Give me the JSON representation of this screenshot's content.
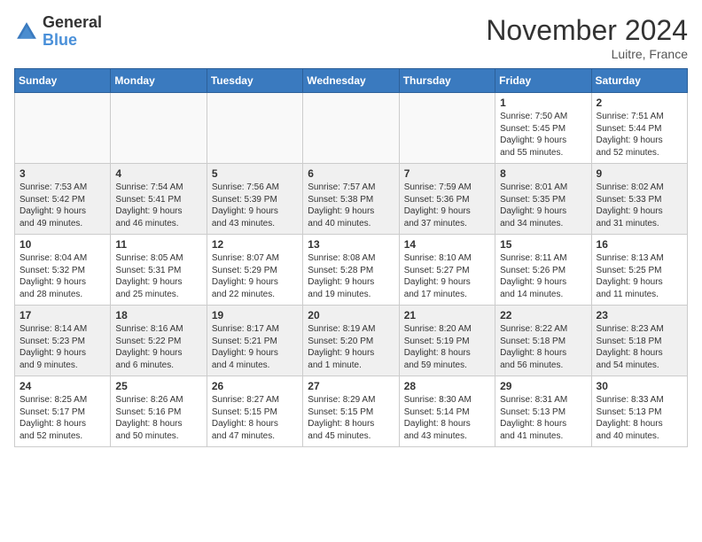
{
  "header": {
    "logo_line1": "General",
    "logo_line2": "Blue",
    "month": "November 2024",
    "location": "Luitre, France"
  },
  "weekdays": [
    "Sunday",
    "Monday",
    "Tuesday",
    "Wednesday",
    "Thursday",
    "Friday",
    "Saturday"
  ],
  "weeks": [
    [
      {
        "day": "",
        "text": "",
        "empty": true
      },
      {
        "day": "",
        "text": "",
        "empty": true
      },
      {
        "day": "",
        "text": "",
        "empty": true
      },
      {
        "day": "",
        "text": "",
        "empty": true
      },
      {
        "day": "",
        "text": "",
        "empty": true
      },
      {
        "day": "1",
        "text": "Sunrise: 7:50 AM\nSunset: 5:45 PM\nDaylight: 9 hours\nand 55 minutes.",
        "empty": false
      },
      {
        "day": "2",
        "text": "Sunrise: 7:51 AM\nSunset: 5:44 PM\nDaylight: 9 hours\nand 52 minutes.",
        "empty": false
      }
    ],
    [
      {
        "day": "3",
        "text": "Sunrise: 7:53 AM\nSunset: 5:42 PM\nDaylight: 9 hours\nand 49 minutes.",
        "empty": false
      },
      {
        "day": "4",
        "text": "Sunrise: 7:54 AM\nSunset: 5:41 PM\nDaylight: 9 hours\nand 46 minutes.",
        "empty": false
      },
      {
        "day": "5",
        "text": "Sunrise: 7:56 AM\nSunset: 5:39 PM\nDaylight: 9 hours\nand 43 minutes.",
        "empty": false
      },
      {
        "day": "6",
        "text": "Sunrise: 7:57 AM\nSunset: 5:38 PM\nDaylight: 9 hours\nand 40 minutes.",
        "empty": false
      },
      {
        "day": "7",
        "text": "Sunrise: 7:59 AM\nSunset: 5:36 PM\nDaylight: 9 hours\nand 37 minutes.",
        "empty": false
      },
      {
        "day": "8",
        "text": "Sunrise: 8:01 AM\nSunset: 5:35 PM\nDaylight: 9 hours\nand 34 minutes.",
        "empty": false
      },
      {
        "day": "9",
        "text": "Sunrise: 8:02 AM\nSunset: 5:33 PM\nDaylight: 9 hours\nand 31 minutes.",
        "empty": false
      }
    ],
    [
      {
        "day": "10",
        "text": "Sunrise: 8:04 AM\nSunset: 5:32 PM\nDaylight: 9 hours\nand 28 minutes.",
        "empty": false
      },
      {
        "day": "11",
        "text": "Sunrise: 8:05 AM\nSunset: 5:31 PM\nDaylight: 9 hours\nand 25 minutes.",
        "empty": false
      },
      {
        "day": "12",
        "text": "Sunrise: 8:07 AM\nSunset: 5:29 PM\nDaylight: 9 hours\nand 22 minutes.",
        "empty": false
      },
      {
        "day": "13",
        "text": "Sunrise: 8:08 AM\nSunset: 5:28 PM\nDaylight: 9 hours\nand 19 minutes.",
        "empty": false
      },
      {
        "day": "14",
        "text": "Sunrise: 8:10 AM\nSunset: 5:27 PM\nDaylight: 9 hours\nand 17 minutes.",
        "empty": false
      },
      {
        "day": "15",
        "text": "Sunrise: 8:11 AM\nSunset: 5:26 PM\nDaylight: 9 hours\nand 14 minutes.",
        "empty": false
      },
      {
        "day": "16",
        "text": "Sunrise: 8:13 AM\nSunset: 5:25 PM\nDaylight: 9 hours\nand 11 minutes.",
        "empty": false
      }
    ],
    [
      {
        "day": "17",
        "text": "Sunrise: 8:14 AM\nSunset: 5:23 PM\nDaylight: 9 hours\nand 9 minutes.",
        "empty": false
      },
      {
        "day": "18",
        "text": "Sunrise: 8:16 AM\nSunset: 5:22 PM\nDaylight: 9 hours\nand 6 minutes.",
        "empty": false
      },
      {
        "day": "19",
        "text": "Sunrise: 8:17 AM\nSunset: 5:21 PM\nDaylight: 9 hours\nand 4 minutes.",
        "empty": false
      },
      {
        "day": "20",
        "text": "Sunrise: 8:19 AM\nSunset: 5:20 PM\nDaylight: 9 hours\nand 1 minute.",
        "empty": false
      },
      {
        "day": "21",
        "text": "Sunrise: 8:20 AM\nSunset: 5:19 PM\nDaylight: 8 hours\nand 59 minutes.",
        "empty": false
      },
      {
        "day": "22",
        "text": "Sunrise: 8:22 AM\nSunset: 5:18 PM\nDaylight: 8 hours\nand 56 minutes.",
        "empty": false
      },
      {
        "day": "23",
        "text": "Sunrise: 8:23 AM\nSunset: 5:18 PM\nDaylight: 8 hours\nand 54 minutes.",
        "empty": false
      }
    ],
    [
      {
        "day": "24",
        "text": "Sunrise: 8:25 AM\nSunset: 5:17 PM\nDaylight: 8 hours\nand 52 minutes.",
        "empty": false
      },
      {
        "day": "25",
        "text": "Sunrise: 8:26 AM\nSunset: 5:16 PM\nDaylight: 8 hours\nand 50 minutes.",
        "empty": false
      },
      {
        "day": "26",
        "text": "Sunrise: 8:27 AM\nSunset: 5:15 PM\nDaylight: 8 hours\nand 47 minutes.",
        "empty": false
      },
      {
        "day": "27",
        "text": "Sunrise: 8:29 AM\nSunset: 5:15 PM\nDaylight: 8 hours\nand 45 minutes.",
        "empty": false
      },
      {
        "day": "28",
        "text": "Sunrise: 8:30 AM\nSunset: 5:14 PM\nDaylight: 8 hours\nand 43 minutes.",
        "empty": false
      },
      {
        "day": "29",
        "text": "Sunrise: 8:31 AM\nSunset: 5:13 PM\nDaylight: 8 hours\nand 41 minutes.",
        "empty": false
      },
      {
        "day": "30",
        "text": "Sunrise: 8:33 AM\nSunset: 5:13 PM\nDaylight: 8 hours\nand 40 minutes.",
        "empty": false
      }
    ]
  ]
}
